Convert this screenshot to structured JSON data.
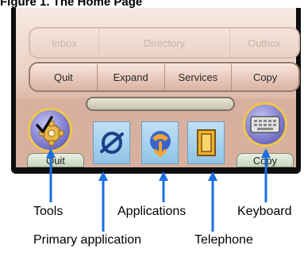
{
  "header": {
    "text": "Figure 1. The Home Page"
  },
  "top_row": [
    "Inbox",
    "Directory",
    "Outbox"
  ],
  "command_row": [
    "Quit",
    "Expand",
    "Services",
    "Copy"
  ],
  "tabs": {
    "left": "Quit",
    "right": "Copy"
  },
  "callouts": {
    "tools": "Tools",
    "applications": "Applications",
    "keyboard": "Keyboard",
    "primary_application": "Primary application",
    "telephone": "Telephone"
  },
  "colors": {
    "arrow": "#1a6fe0",
    "button_ring": "#f1c54a",
    "tile": "#a8d2ee"
  }
}
